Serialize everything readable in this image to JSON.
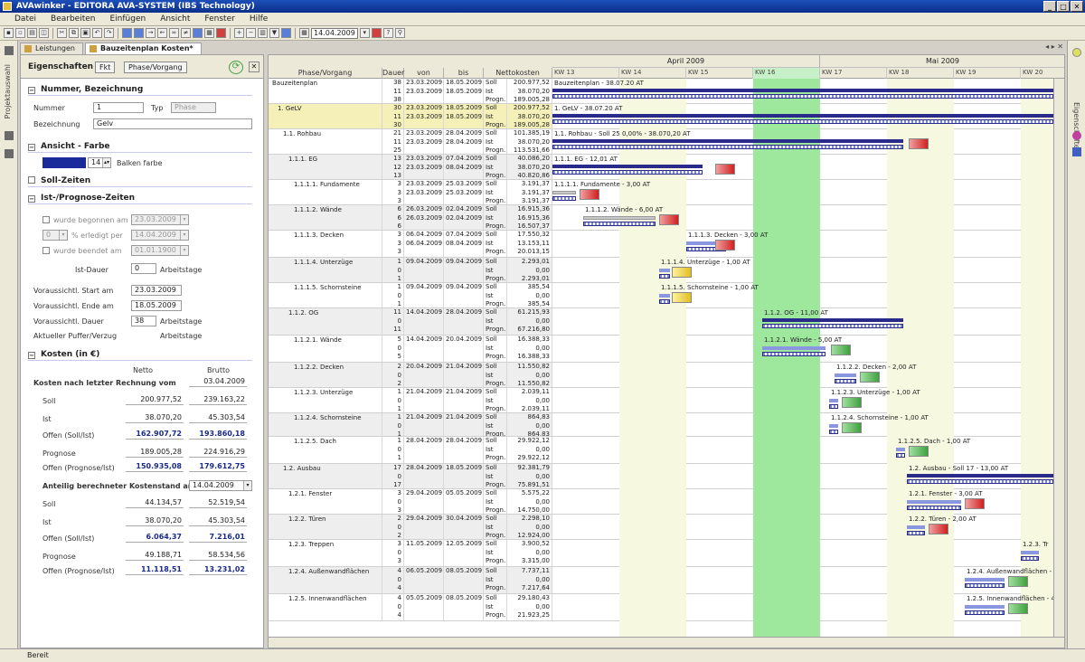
{
  "window": {
    "title": "AVAwinker - EDITORA AVA-SYSTEM (IBS Technology)"
  },
  "menu": [
    "Datei",
    "Bearbeiten",
    "Einfügen",
    "Ansicht",
    "Fenster",
    "Hilfe"
  ],
  "toolbar": {
    "date": "14.04.2009"
  },
  "tabs": [
    {
      "label": "Leistungen"
    },
    {
      "label": "Bauzeitenplan Kosten*"
    }
  ],
  "left_strip_label": "Projektauswahl",
  "right_strip_label": "Eigenschaften",
  "props": {
    "title": "Eigenschaften",
    "btn1": "Fkt",
    "btn2": "Phase/Vorgang",
    "sec_nummer": "Nummer, Bezeichnung",
    "nummer_label": "Nummer",
    "nummer_value": "1",
    "typ_label": "Typ",
    "typ_value": "Phase",
    "bezeichnung_label": "Bezeichnung",
    "bezeichnung_value": "Gelv",
    "sec_ansicht": "Ansicht - Farbe",
    "balken_value": "14",
    "balken_label": "Balken farbe",
    "sec_soll": "Soll-Zeiten",
    "sec_ist": "Ist-/Prognose-Zeiten",
    "begonnen_label": "wurde begonnen am",
    "begonnen_value": "23.03.2009",
    "erledigt_value": "0",
    "erledigt_label": "% erledigt per",
    "erledigt_date": "14.04.2009",
    "beendet_label": "wurde beendet am",
    "beendet_value": "01.01.1900",
    "istdauer_label": "Ist-Dauer",
    "istdauer_value": "0",
    "istdauer_unit": "Arbeitstage",
    "start_label": "Voraussichtl. Start am",
    "start_value": "23.03.2009",
    "ende_label": "Voraussichtl. Ende am",
    "ende_value": "18.05.2009",
    "dauer_label": "Voraussichtl. Dauer",
    "dauer_value": "38",
    "dauer_unit": "Arbeitstage",
    "puffer_label": "Aktueller Puffer/Verzug",
    "puffer_unit": "Arbeitstage",
    "sec_kosten": "Kosten (in €)",
    "col_netto": "Netto",
    "col_brutto": "Brutto",
    "nach_rechnung_label": "Kosten nach letzter Rechnung vom",
    "nach_rechnung_date": "03.04.2009",
    "rows1": [
      {
        "label": "Soll",
        "netto": "200.977,52",
        "brutto": "239.163,22",
        "bold": false
      },
      {
        "label": "Ist",
        "netto": "38.070,20",
        "brutto": "45.303,54",
        "bold": false
      },
      {
        "label": "Offen (Soll/Ist)",
        "netto": "162.907,72",
        "brutto": "193.860,18",
        "bold": true
      },
      {
        "label": "Prognose",
        "netto": "189.005,28",
        "brutto": "224.916,29",
        "bold": false
      },
      {
        "label": "Offen (Prognose/Ist)",
        "netto": "150.935,08",
        "brutto": "179.612,75",
        "bold": true
      }
    ],
    "anteilig_label": "Anteilig berechneter Kostenstand am",
    "anteilig_date": "14.04.2009",
    "rows2": [
      {
        "label": "Soll",
        "netto": "44.134,57",
        "brutto": "52.519,54",
        "bold": false
      },
      {
        "label": "Ist",
        "netto": "38.070,20",
        "brutto": "45.303,54",
        "bold": false
      },
      {
        "label": "Offen (Soll/Ist)",
        "netto": "6.064,37",
        "brutto": "7.216,01",
        "bold": true
      },
      {
        "label": "Prognose",
        "netto": "49.188,71",
        "brutto": "58.534,56",
        "bold": false
      },
      {
        "label": "Offen (Prognose/Ist)",
        "netto": "11.118,51",
        "brutto": "13.231,02",
        "bold": true
      }
    ]
  },
  "grid": {
    "columns": {
      "phase": "Phase/Vorgang",
      "dauer": "Dauer",
      "von": "von",
      "bis": "bis",
      "kosten": "Nettokosten"
    },
    "months": [
      "April 2009",
      "Mai 2009"
    ],
    "weeks": [
      "KW 13",
      "KW 14",
      "KW 15",
      "KW 16",
      "KW 17",
      "KW 18",
      "KW 19",
      "KW 20"
    ],
    "rows": [
      {
        "name": "Bauzeitenplan",
        "expand": "-",
        "dauer": [
          "38",
          "11",
          "38"
        ],
        "von": [
          "23.03.2009",
          "23.03.2009",
          ""
        ],
        "bis": [
          "18.05.2009",
          "18.05.2009",
          ""
        ],
        "typ": [
          "Soll",
          "Ist",
          "Progn."
        ],
        "kosten": [
          "200.977,52",
          "38.070,20",
          "189.005,28"
        ],
        "gantt": "Bauzeitenplan - 38.07.20 AT",
        "hl": false
      },
      {
        "name": "1. GeLV",
        "expand": "-",
        "dauer": [
          "30",
          "11",
          "30"
        ],
        "von": [
          "23.03.2009",
          "23.03.2009",
          ""
        ],
        "bis": [
          "18.05.2009",
          "18.05.2009",
          ""
        ],
        "typ": [
          "Soll",
          "Ist",
          "Progn."
        ],
        "kosten": [
          "200.977,52",
          "38.070,20",
          "189.005,28"
        ],
        "gantt": "1. GeLV - 38.07.20 AT",
        "hl": true
      },
      {
        "name": "1.1. Rohbau",
        "expand": "-",
        "dauer": [
          "21",
          "11",
          "25"
        ],
        "von": [
          "23.03.2009",
          "23.03.2009",
          ""
        ],
        "bis": [
          "28.04.2009",
          "28.04.2009",
          ""
        ],
        "typ": [
          "Soll",
          "Ist",
          "Progn."
        ],
        "kosten": [
          "101.385,19",
          "38.070,20",
          "113.531,66"
        ],
        "gantt": "1.1. Rohbau - Soll 25 0,00% - 38.070,20 AT",
        "hl": false
      },
      {
        "name": "1.1.1. EG",
        "expand": "-",
        "dauer": [
          "13",
          "12",
          "13"
        ],
        "von": [
          "23.03.2009",
          "23.03.2009",
          ""
        ],
        "bis": [
          "07.04.2009",
          "08.04.2009",
          ""
        ],
        "typ": [
          "Soll",
          "Ist",
          "Progn."
        ],
        "kosten": [
          "40.086,20",
          "38.070,20",
          "40.820,86"
        ],
        "gantt": "1.1.1. EG - 12,01 AT",
        "hl": false
      },
      {
        "name": "1.1.1.1. Fundamente",
        "expand": "",
        "dauer": [
          "3",
          "3",
          "3"
        ],
        "von": [
          "23.03.2009",
          "23.03.2009",
          ""
        ],
        "bis": [
          "25.03.2009",
          "25.03.2009",
          ""
        ],
        "typ": [
          "Soll",
          "Ist",
          "Progn."
        ],
        "kosten": [
          "3.191,37",
          "3.191,37",
          "3.191,37"
        ],
        "gantt": "1.1.1.1. Fundamente - 3,00 AT",
        "hl": false
      },
      {
        "name": "1.1.1.2. Wände",
        "expand": "",
        "dauer": [
          "6",
          "6",
          "6"
        ],
        "von": [
          "26.03.2009",
          "26.03.2009",
          ""
        ],
        "bis": [
          "02.04.2009",
          "02.04.2009",
          ""
        ],
        "typ": [
          "Soll",
          "Ist",
          "Progn."
        ],
        "kosten": [
          "16.915,36",
          "16.915,36",
          "16.507,37"
        ],
        "gantt": "1.1.1.2. Wände - 6,00 AT",
        "hl": false
      },
      {
        "name": "1.1.1.3. Decken",
        "expand": "",
        "dauer": [
          "3",
          "3",
          "3"
        ],
        "von": [
          "06.04.2009",
          "06.04.2009",
          ""
        ],
        "bis": [
          "07.04.2009",
          "08.04.2009",
          ""
        ],
        "typ": [
          "Soll",
          "Ist",
          "Progn."
        ],
        "kosten": [
          "17.550,32",
          "13.153,11",
          "20.013,15"
        ],
        "gantt": "1.1.1.3. Decken - 3,00 AT",
        "hl": false
      },
      {
        "name": "1.1.1.4. Unterzüge",
        "expand": "",
        "dauer": [
          "1",
          "0",
          "1"
        ],
        "von": [
          "09.04.2009",
          "",
          ""
        ],
        "bis": [
          "09.04.2009",
          "",
          ""
        ],
        "typ": [
          "Soll",
          "Ist",
          "Progn."
        ],
        "kosten": [
          "2.293,01",
          "0,00",
          "2.293,01"
        ],
        "gantt": "1.1.1.4. Unterzüge - 1,00 AT",
        "hl": false
      },
      {
        "name": "1.1.1.5. Schornsteine",
        "expand": "",
        "dauer": [
          "1",
          "0",
          "1"
        ],
        "von": [
          "09.04.2009",
          "",
          ""
        ],
        "bis": [
          "09.04.2009",
          "",
          ""
        ],
        "typ": [
          "Soll",
          "Ist",
          "Progn."
        ],
        "kosten": [
          "385,54",
          "0,00",
          "385,54"
        ],
        "gantt": "1.1.1.5. Schornsteine - 1,00 AT",
        "hl": false
      },
      {
        "name": "1.1.2. OG",
        "expand": "-",
        "dauer": [
          "11",
          "0",
          "11"
        ],
        "von": [
          "14.04.2009",
          "",
          ""
        ],
        "bis": [
          "28.04.2009",
          "",
          ""
        ],
        "typ": [
          "Soll",
          "Ist",
          "Progn."
        ],
        "kosten": [
          "61.215,93",
          "0,00",
          "67.216,80"
        ],
        "gantt": "1.1.2. OG - 11,00 AT",
        "hl": false
      },
      {
        "name": "1.1.2.1. Wände",
        "expand": "",
        "dauer": [
          "5",
          "0",
          "5"
        ],
        "von": [
          "14.04.2009",
          "",
          ""
        ],
        "bis": [
          "20.04.2009",
          "",
          ""
        ],
        "typ": [
          "Soll",
          "Ist",
          "Progn."
        ],
        "kosten": [
          "16.388,33",
          "0,00",
          "16.388,33"
        ],
        "gantt": "1.1.2.1. Wände - 5,00 AT",
        "hl": false
      },
      {
        "name": "1.1.2.2. Decken",
        "expand": "",
        "dauer": [
          "2",
          "0",
          "2"
        ],
        "von": [
          "20.04.2009",
          "",
          ""
        ],
        "bis": [
          "21.04.2009",
          "",
          ""
        ],
        "typ": [
          "Soll",
          "Ist",
          "Progn."
        ],
        "kosten": [
          "11.550,82",
          "0,00",
          "11.550,82"
        ],
        "gantt": "1.1.2.2. Decken - 2,00 AT",
        "hl": false
      },
      {
        "name": "1.1.2.3. Unterzüge",
        "expand": "",
        "dauer": [
          "1",
          "0",
          "1"
        ],
        "von": [
          "21.04.2009",
          "",
          ""
        ],
        "bis": [
          "21.04.2009",
          "",
          ""
        ],
        "typ": [
          "Soll",
          "Ist",
          "Progn."
        ],
        "kosten": [
          "2.039,11",
          "0,00",
          "2.039,11"
        ],
        "gantt": "1.1.2.3. Unterzüge - 1,00 AT",
        "hl": false
      },
      {
        "name": "1.1.2.4. Schornsteine",
        "expand": "",
        "dauer": [
          "1",
          "0",
          "1"
        ],
        "von": [
          "21.04.2009",
          "",
          ""
        ],
        "bis": [
          "21.04.2009",
          "",
          ""
        ],
        "typ": [
          "Soll",
          "Ist",
          "Progn."
        ],
        "kosten": [
          "864,83",
          "0,00",
          "864,83"
        ],
        "gantt": "1.1.2.4. Schornsteine - 1,00 AT",
        "hl": false
      },
      {
        "name": "1.1.2.5. Dach",
        "expand": "",
        "dauer": [
          "1",
          "0",
          "1"
        ],
        "von": [
          "28.04.2009",
          "",
          ""
        ],
        "bis": [
          "28.04.2009",
          "",
          ""
        ],
        "typ": [
          "Soll",
          "Ist",
          "Progn."
        ],
        "kosten": [
          "29.922,12",
          "0,00",
          "29.922,12"
        ],
        "gantt": "1.1.2.5. Dach - 1,00 AT",
        "hl": false
      },
      {
        "name": "1.2. Ausbau",
        "expand": "-",
        "dauer": [
          "17",
          "0",
          "17"
        ],
        "von": [
          "28.04.2009",
          "",
          ""
        ],
        "bis": [
          "18.05.2009",
          "",
          ""
        ],
        "typ": [
          "Soll",
          "Ist",
          "Progn."
        ],
        "kosten": [
          "92.381,79",
          "0,00",
          "75.891,51"
        ],
        "gantt": "1.2. Ausbau - Soll 17 - 13,00 AT",
        "hl": false
      },
      {
        "name": "1.2.1. Fenster",
        "expand": "",
        "dauer": [
          "3",
          "0",
          "3"
        ],
        "von": [
          "29.04.2009",
          "",
          ""
        ],
        "bis": [
          "05.05.2009",
          "",
          ""
        ],
        "typ": [
          "Soll",
          "Ist",
          "Progn."
        ],
        "kosten": [
          "5.575,22",
          "0,00",
          "14.750,00"
        ],
        "gantt": "1.2.1. Fenster - 3,00 AT",
        "hl": false
      },
      {
        "name": "1.2.2. Türen",
        "expand": "",
        "dauer": [
          "2",
          "0",
          "2"
        ],
        "von": [
          "29.04.2009",
          "",
          ""
        ],
        "bis": [
          "30.04.2009",
          "",
          ""
        ],
        "typ": [
          "Soll",
          "Ist",
          "Progn."
        ],
        "kosten": [
          "2.298,10",
          "0,00",
          "12.924,00"
        ],
        "gantt": "1.2.2. Türen - 2,00 AT",
        "hl": false
      },
      {
        "name": "1.2.3. Treppen",
        "expand": "",
        "dauer": [
          "3",
          "0",
          "3"
        ],
        "von": [
          "11.05.2009",
          "",
          ""
        ],
        "bis": [
          "12.05.2009",
          "",
          ""
        ],
        "typ": [
          "Soll",
          "Ist",
          "Progn."
        ],
        "kosten": [
          "3.900,52",
          "0,00",
          "3.315,00"
        ],
        "gantt": "1.2.3. Tr",
        "hl": false
      },
      {
        "name": "1.2.4. Außenwandflächen",
        "expand": "",
        "dauer": [
          "4",
          "0",
          "4"
        ],
        "von": [
          "06.05.2009",
          "",
          ""
        ],
        "bis": [
          "08.05.2009",
          "",
          ""
        ],
        "typ": [
          "Soll",
          "Ist",
          "Progn."
        ],
        "kosten": [
          "7.737,11",
          "0,00",
          "7.217,64"
        ],
        "gantt": "1.2.4. Außenwandflächen - 4",
        "hl": false
      },
      {
        "name": "1.2.5. Innenwandflächen",
        "expand": "",
        "dauer": [
          "4",
          "0",
          "4"
        ],
        "von": [
          "05.05.2009",
          "",
          ""
        ],
        "bis": [
          "08.05.2009",
          "",
          ""
        ],
        "typ": [
          "Soll",
          "Ist",
          "Progn."
        ],
        "kosten": [
          "29.180,43",
          "0,00",
          "21.923,25"
        ],
        "gantt": "1.2.5. Innenwandflächen - 4",
        "hl": false
      }
    ]
  },
  "status": "Bereit"
}
